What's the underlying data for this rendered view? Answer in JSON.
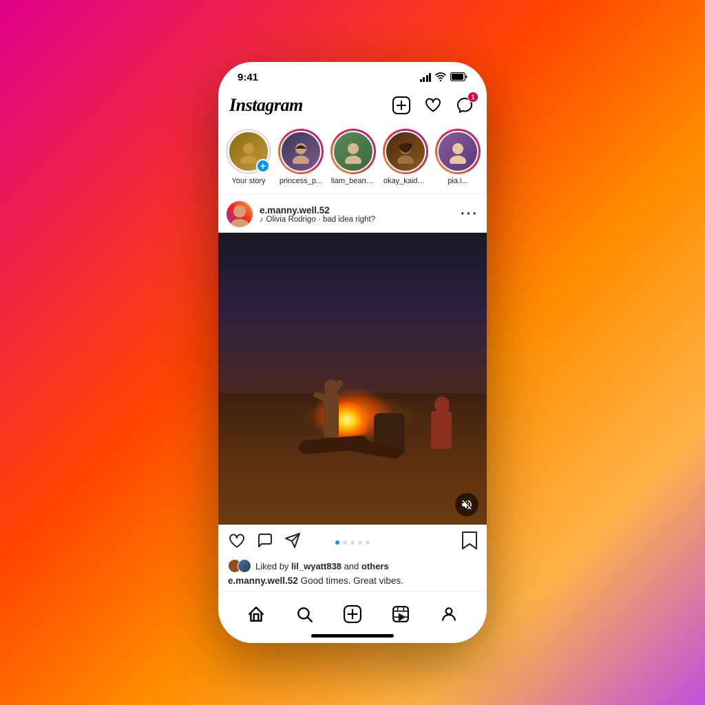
{
  "background": {
    "gradient_start": "#e0008c",
    "gradient_end": "#ffb347"
  },
  "status_bar": {
    "time": "9:41",
    "signal_label": "signal",
    "wifi_label": "wifi",
    "battery_label": "battery"
  },
  "header": {
    "logo": "Instagram",
    "add_icon_label": "add",
    "activity_icon_label": "activity",
    "messages_icon_label": "messages",
    "messages_badge": "1"
  },
  "stories": [
    {
      "username": "Your story",
      "avatar_emoji": "😄",
      "avatar_class": "avatar-you",
      "has_ring": false,
      "has_add_badge": true
    },
    {
      "username": "princess_p...",
      "avatar_emoji": "👩",
      "avatar_class": "avatar-pp",
      "has_ring": true,
      "has_add_badge": false
    },
    {
      "username": "liam_beanz...",
      "avatar_emoji": "🧑",
      "avatar_class": "avatar-lb",
      "has_ring": true,
      "has_add_badge": false
    },
    {
      "username": "okay_kaide...",
      "avatar_emoji": "🧑",
      "avatar_class": "avatar-ok",
      "has_ring": true,
      "has_add_badge": false
    },
    {
      "username": "pia.i...",
      "avatar_emoji": "👱",
      "avatar_class": "avatar-pia",
      "has_ring": true,
      "has_add_badge": false
    }
  ],
  "post": {
    "username": "e.manny.well.52",
    "music": "Olivia Rodrigo · bad idea right?",
    "music_note": "♪",
    "dots": [
      true,
      false,
      false,
      false,
      false
    ],
    "liked_by": "lil_wyatt838",
    "liked_by_others": "others",
    "likes_text": "Liked by",
    "caption_username": "e.manny.well.52",
    "caption_text": "Good times. Great vibes."
  },
  "bottom_nav": {
    "home_label": "home",
    "search_label": "search",
    "add_label": "add",
    "reels_label": "reels",
    "profile_label": "profile"
  }
}
